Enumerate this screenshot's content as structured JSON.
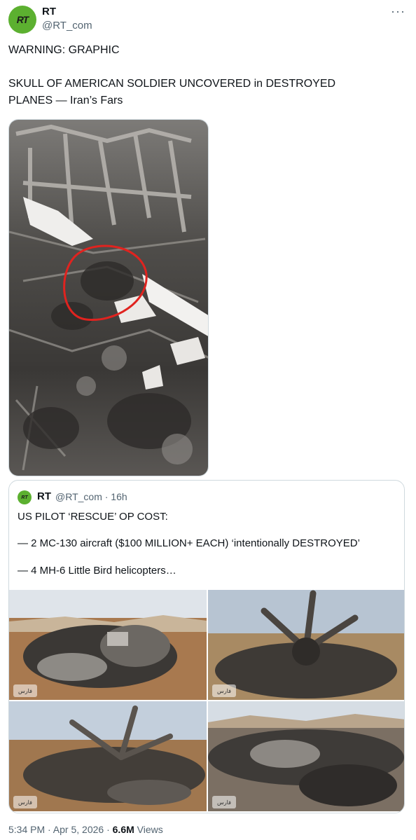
{
  "author": {
    "avatar_text": "RT",
    "name": "RT",
    "handle": "@RT_com",
    "more_glyph": "···"
  },
  "tweet": {
    "line1": "WARNING: GRAPHIC",
    "line2": "SKULL OF AMERICAN SOLDIER UNCOVERED in DESTROYED PLANES — Iran’s Fars"
  },
  "quote": {
    "avatar_text": "RT",
    "name": "RT",
    "meta": "@RT_com · 16h",
    "line1": "US PILOT ‘RESCUE’ OP COST:",
    "line2": "— 2 MC-130 aircraft ($100 MILLION+ EACH) ‘intentionally DESTROYED’",
    "line3": "— 4 MH-6 Little Bird helicopters…",
    "watermark": "فارس"
  },
  "footer": {
    "time": "5:34 PM · Apr 5, 2026 · ",
    "views_count": "6.6M",
    "views_label": " Views"
  },
  "icons": {
    "more": "more-icon",
    "annotation": "red-circle-annotation"
  }
}
